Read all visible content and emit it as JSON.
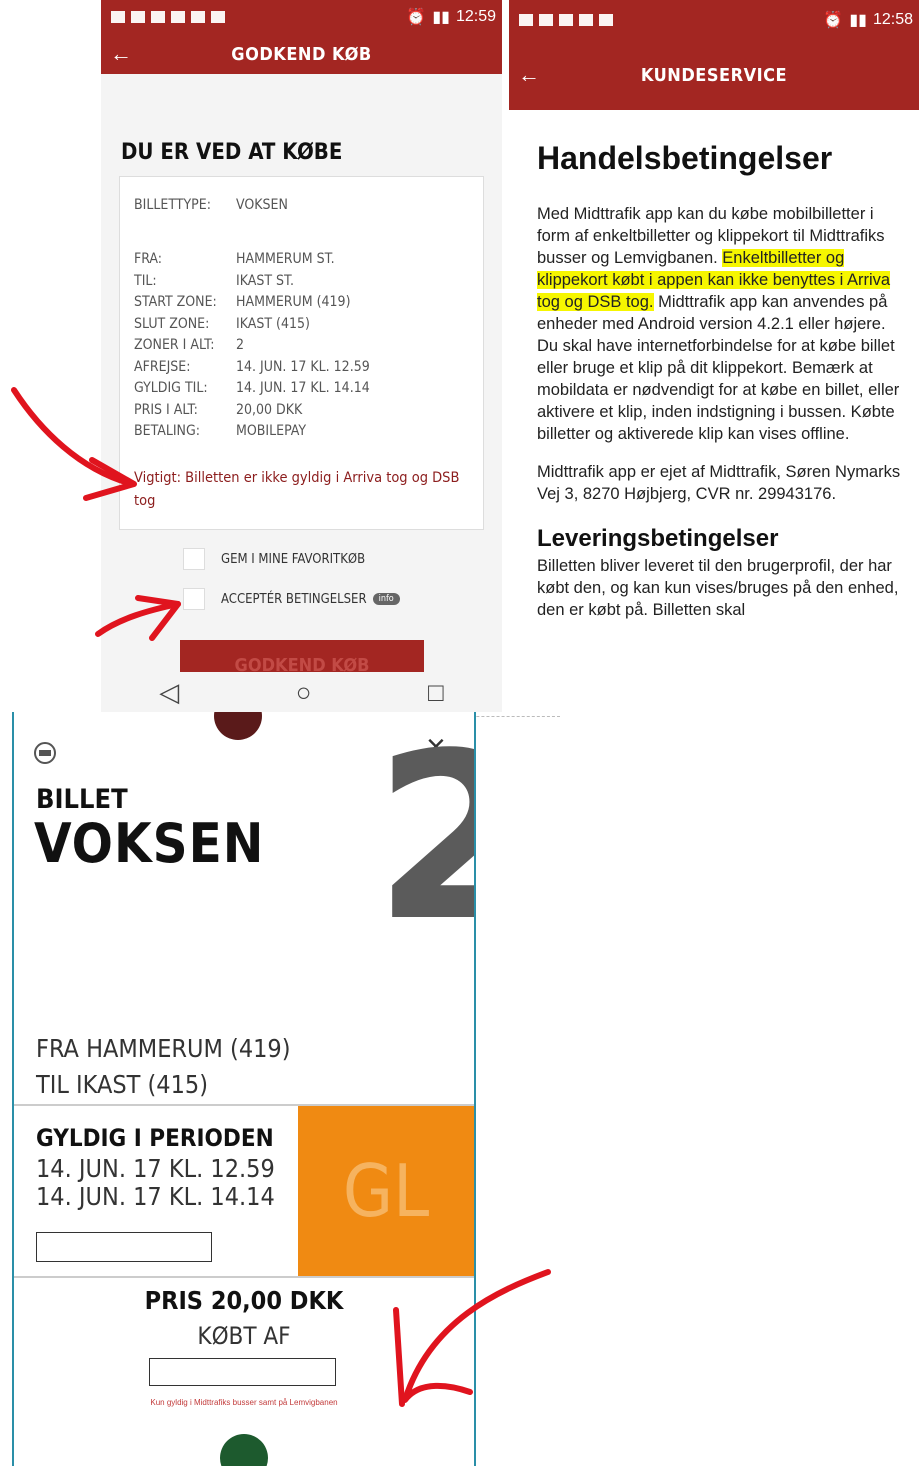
{
  "screen1": {
    "status_time": "12:59",
    "app_title": "GODKEND KØB",
    "heading": "DU ER VED AT KØBE",
    "ticket_type_label": "BILLETTYPE:",
    "ticket_type_value": "VOKSEN",
    "details": [
      {
        "label": "FRA:",
        "value": "HAMMERUM ST."
      },
      {
        "label": "TIL:",
        "value": "IKAST ST."
      },
      {
        "label": "START ZONE:",
        "value": "HAMMERUM (419)"
      },
      {
        "label": "SLUT ZONE:",
        "value": "IKAST (415)"
      },
      {
        "label": "ZONER I ALT:",
        "value": "2"
      },
      {
        "label": "AFREJSE:",
        "value": "14. JUN. 17 KL. 12.59"
      },
      {
        "label": "GYLDIG TIL:",
        "value": "14. JUN. 17 KL. 14.14"
      },
      {
        "label": "PRIS I ALT:",
        "value": "20,00 DKK"
      },
      {
        "label": "BETALING:",
        "value": "MOBILEPAY"
      }
    ],
    "warning": "Vigtigt: Billetten er ikke gyldig i Arriva tog og DSB tog",
    "favorite_label": "GEM I MINE FAVORITKØB",
    "accept_label": "ACCEPTÉR BETINGELSER",
    "info_badge": "info",
    "approve_button": "GODKEND KØB"
  },
  "screen2": {
    "status_time": "12:58",
    "app_title": "KUNDESERVICE",
    "heading": "Handelsbetingelser",
    "p1_a": "Med Midttrafik app kan du købe mobilbilletter i form af enkeltbilletter og klippekort til Midttrafiks busser og Lemvigbanen. ",
    "p1_highlight": "Enkeltbilletter og klippekort købt i appen kan ikke benyttes i Arriva tog og DSB tog.",
    "p1_b": " Midttrafik app kan anvendes på enheder med Android version 4.2.1 eller højere. Du skal have internetforbindelse for at købe billet eller bruge et klip på dit klippekort. Bemærk at mobildata er nødvendigt for at købe en billet, eller aktivere et klip, inden indstigning i bussen. Købte billetter og aktiverede klip kan vises offline.",
    "p2": "Midttrafik app er ejet af Midttrafik, Søren Nymarks Vej 3, 8270 Højbjerg, CVR nr. 29943176.",
    "heading2": "Leveringsbetingelser",
    "p3": "Billetten bliver leveret til den brugerprofil, der har købt den, og kan kun vises/bruges på den enhed, den er købt på. Billetten skal"
  },
  "ticket": {
    "title_small": "BILLET",
    "title_big": "VOKSEN",
    "zone_count": "2",
    "from": "FRA HAMMERUM (419)",
    "to": "TIL IKAST (415)",
    "valid_label": "GYLDIG I PERIODEN",
    "valid_from": "14. JUN. 17 KL. 12.59",
    "valid_to": "14. JUN. 17 KL. 14.14",
    "code": "GL",
    "price": "PRIS 20,00 DKK",
    "bought_by": "KØBT AF",
    "footnote": "Kun gyldig i Midttrafiks busser samt på Lemvigbanen",
    "close_symbol": "×"
  },
  "colors": {
    "brand_red": "#a32622",
    "annotation_red": "#e0141e",
    "orange": "#f08a12",
    "highlight": "#f6f600"
  }
}
